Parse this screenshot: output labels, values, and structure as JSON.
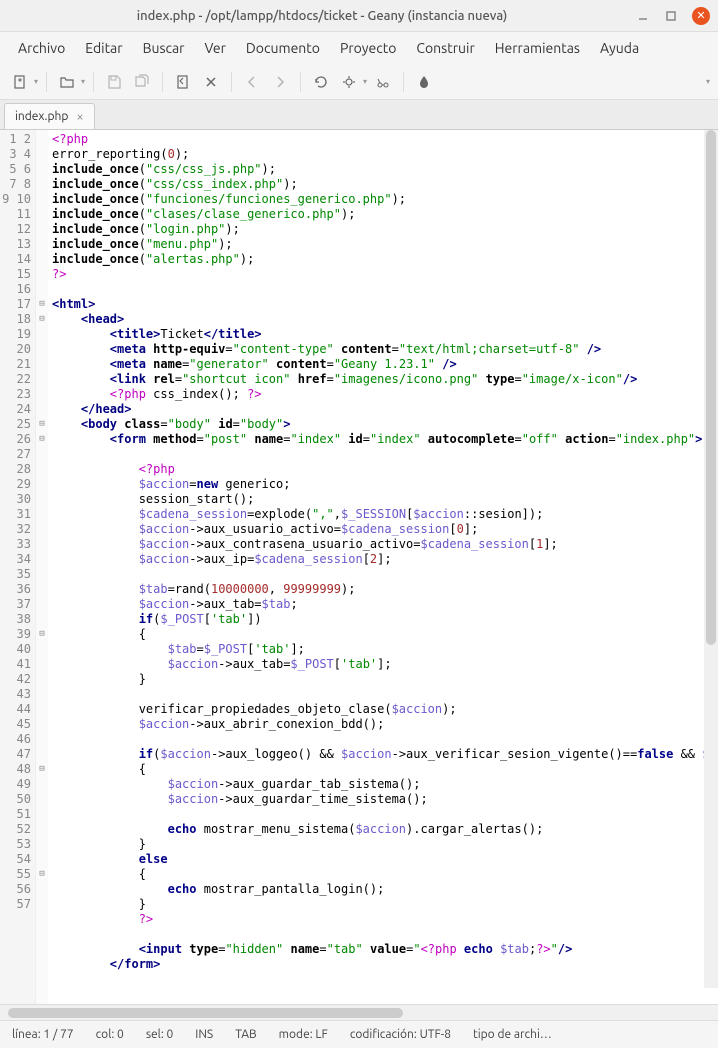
{
  "window": {
    "title": "index.php - /opt/lampp/htdocs/ticket - Geany (instancia nueva)"
  },
  "menu": {
    "archivo": "Archivo",
    "editar": "Editar",
    "buscar": "Buscar",
    "ver": "Ver",
    "documento": "Documento",
    "proyecto": "Proyecto",
    "construir": "Construir",
    "herramientas": "Herramientas",
    "ayuda": "Ayuda"
  },
  "tab": {
    "name": "index.php"
  },
  "status": {
    "linea": "línea: 1 / 77",
    "col": "col: 0",
    "sel": "sel: 0",
    "ins": "INS",
    "tab": "TAB",
    "mode": "mode: LF",
    "cod": "codificación: UTF-8",
    "tipo": "tipo de archi…"
  },
  "gutter": {
    "start": 1,
    "end": 57
  },
  "fold": {
    "12": "⊟",
    "13": "⊟",
    "20": "⊟",
    "21": "⊟",
    "34": "⊟",
    "43": "⊟",
    "50": "⊟"
  },
  "code": [
    {
      "t": "pp",
      "txt": "<?php"
    },
    {
      "raw": "error_reporting(<span class='num'>0</span>);"
    },
    {
      "raw": "<span class='fn'>include_once</span>(<span class='str'>\"css/css_js.php\"</span>);"
    },
    {
      "raw": "<span class='fn'>include_once</span>(<span class='str'>\"css/css_index.php\"</span>);"
    },
    {
      "raw": "<span class='fn'>include_once</span>(<span class='str'>\"funciones/funciones_generico.php\"</span>);"
    },
    {
      "raw": "<span class='fn'>include_once</span>(<span class='str'>\"clases/clase_generico.php\"</span>);"
    },
    {
      "raw": "<span class='fn'>include_once</span>(<span class='str'>\"login.php\"</span>);"
    },
    {
      "raw": "<span class='fn'>include_once</span>(<span class='str'>\"menu.php\"</span>);"
    },
    {
      "raw": "<span class='fn'>include_once</span>(<span class='str'>\"alertas.php\"</span>);"
    },
    {
      "t": "pp",
      "txt": "?>"
    },
    {
      "raw": ""
    },
    {
      "raw": "<span class='tag'>&lt;html&gt;</span>"
    },
    {
      "raw": "    <span class='tag'>&lt;head&gt;</span>"
    },
    {
      "raw": "        <span class='tag'>&lt;title&gt;</span>Ticket<span class='tag'>&lt;/title&gt;</span>"
    },
    {
      "raw": "        <span class='tag'>&lt;meta</span> <span class='attr'>http-equiv</span>=<span class='aval'>\"content-type\"</span> <span class='attr'>content</span>=<span class='aval'>\"text/html;charset=utf-8\"</span> <span class='tag'>/&gt;</span>"
    },
    {
      "raw": "        <span class='tag'>&lt;meta</span> <span class='attr'>name</span>=<span class='aval'>\"generator\"</span> <span class='attr'>content</span>=<span class='aval'>\"Geany 1.23.1\"</span> <span class='tag'>/&gt;</span>"
    },
    {
      "raw": "        <span class='tag'>&lt;link</span> <span class='attr'>rel</span>=<span class='aval'>\"shortcut icon\"</span> <span class='attr'>href</span>=<span class='aval'>\"imagenes/icono.png\"</span> <span class='attr'>type</span>=<span class='aval'>\"image/x-icon\"</span><span class='tag'>/&gt;</span>"
    },
    {
      "raw": "        <span class='pp'>&lt;?php</span> css_index(); <span class='pp'>?&gt;</span>"
    },
    {
      "raw": "    <span class='tag'>&lt;/head&gt;</span>"
    },
    {
      "raw": "    <span class='tag'>&lt;body</span> <span class='attr'>class</span>=<span class='aval'>\"body\"</span> <span class='attr'>id</span>=<span class='aval'>\"body\"</span><span class='tag'>&gt;</span>"
    },
    {
      "raw": "        <span class='tag'>&lt;form</span> <span class='attr'>method</span>=<span class='aval'>\"post\"</span> <span class='attr'>name</span>=<span class='aval'>\"index\"</span> <span class='attr'>id</span>=<span class='aval'>\"index\"</span> <span class='attr'>autocomplete</span>=<span class='aval'>\"off\"</span> <span class='attr'>action</span>=<span class='aval'>\"index.php\"</span><span class='tag'>&gt;</span>"
    },
    {
      "raw": ""
    },
    {
      "raw": "            <span class='pp'>&lt;?php</span>"
    },
    {
      "raw": "            <span class='var'>$accion</span>=<span class='kw'>new</span> generico;"
    },
    {
      "raw": "            session_start();"
    },
    {
      "raw": "            <span class='var'>$cadena_session</span>=explode(<span class='str'>\",\"</span>,<span class='var'>$_SESSION</span>[<span class='var'>$accion</span>::sesion]);"
    },
    {
      "raw": "            <span class='var'>$accion</span>-&gt;aux_usuario_activo=<span class='var'>$cadena_session</span>[<span class='num'>0</span>];"
    },
    {
      "raw": "            <span class='var'>$accion</span>-&gt;aux_contrasena_usuario_activo=<span class='var'>$cadena_session</span>[<span class='num'>1</span>];"
    },
    {
      "raw": "            <span class='var'>$accion</span>-&gt;aux_ip=<span class='var'>$cadena_session</span>[<span class='num'>2</span>];"
    },
    {
      "raw": ""
    },
    {
      "raw": "            <span class='var'>$tab</span>=rand(<span class='num'>10000000</span>, <span class='num'>99999999</span>);"
    },
    {
      "raw": "            <span class='var'>$accion</span>-&gt;aux_tab=<span class='var'>$tab</span>;"
    },
    {
      "raw": "            <span class='kw'>if</span>(<span class='var'>$_POST</span>[<span class='str'>'tab'</span>])"
    },
    {
      "raw": "            {"
    },
    {
      "raw": "                <span class='var'>$tab</span>=<span class='var'>$_POST</span>[<span class='str'>'tab'</span>];"
    },
    {
      "raw": "                <span class='var'>$accion</span>-&gt;aux_tab=<span class='var'>$_POST</span>[<span class='str'>'tab'</span>];"
    },
    {
      "raw": "            }"
    },
    {
      "raw": ""
    },
    {
      "raw": "            verificar_propiedades_objeto_clase(<span class='var'>$accion</span>);"
    },
    {
      "raw": "            <span class='var'>$accion</span>-&gt;aux_abrir_conexion_bdd();"
    },
    {
      "raw": ""
    },
    {
      "raw": "            <span class='kw'>if</span>(<span class='var'>$accion</span>-&gt;aux_loggeo() &amp;&amp; <span class='var'>$accion</span>-&gt;aux_verificar_sesion_vigente()==<span class='kw'>false</span> &amp;&amp; <span class='var'>$ac</span>"
    },
    {
      "raw": "            {"
    },
    {
      "raw": "                <span class='var'>$accion</span>-&gt;aux_guardar_tab_sistema();"
    },
    {
      "raw": "                <span class='var'>$accion</span>-&gt;aux_guardar_time_sistema();"
    },
    {
      "raw": ""
    },
    {
      "raw": "                <span class='kw'>echo</span> mostrar_menu_sistema(<span class='var'>$accion</span>).cargar_alertas();"
    },
    {
      "raw": "            }"
    },
    {
      "raw": "            <span class='kw'>else</span>"
    },
    {
      "raw": "            {"
    },
    {
      "raw": "                <span class='kw'>echo</span> mostrar_pantalla_login();"
    },
    {
      "raw": "            }"
    },
    {
      "raw": "            <span class='pp'>?&gt;</span>"
    },
    {
      "raw": ""
    },
    {
      "raw": "            <span class='tag'>&lt;input</span> <span class='attr'>type</span>=<span class='aval'>\"hidden\"</span> <span class='attr'>name</span>=<span class='aval'>\"tab\"</span> <span class='attr'>value</span>=<span class='aval'>\"</span><span class='pp'>&lt;?php</span> <span class='kw'>echo</span> <span class='var'>$tab</span>;<span class='pp'>?&gt;</span><span class='aval'>\"</span><span class='tag'>/&gt;</span>"
    },
    {
      "raw": "        <span class='tag'>&lt;/form&gt;</span>"
    },
    {
      "raw": ""
    }
  ]
}
